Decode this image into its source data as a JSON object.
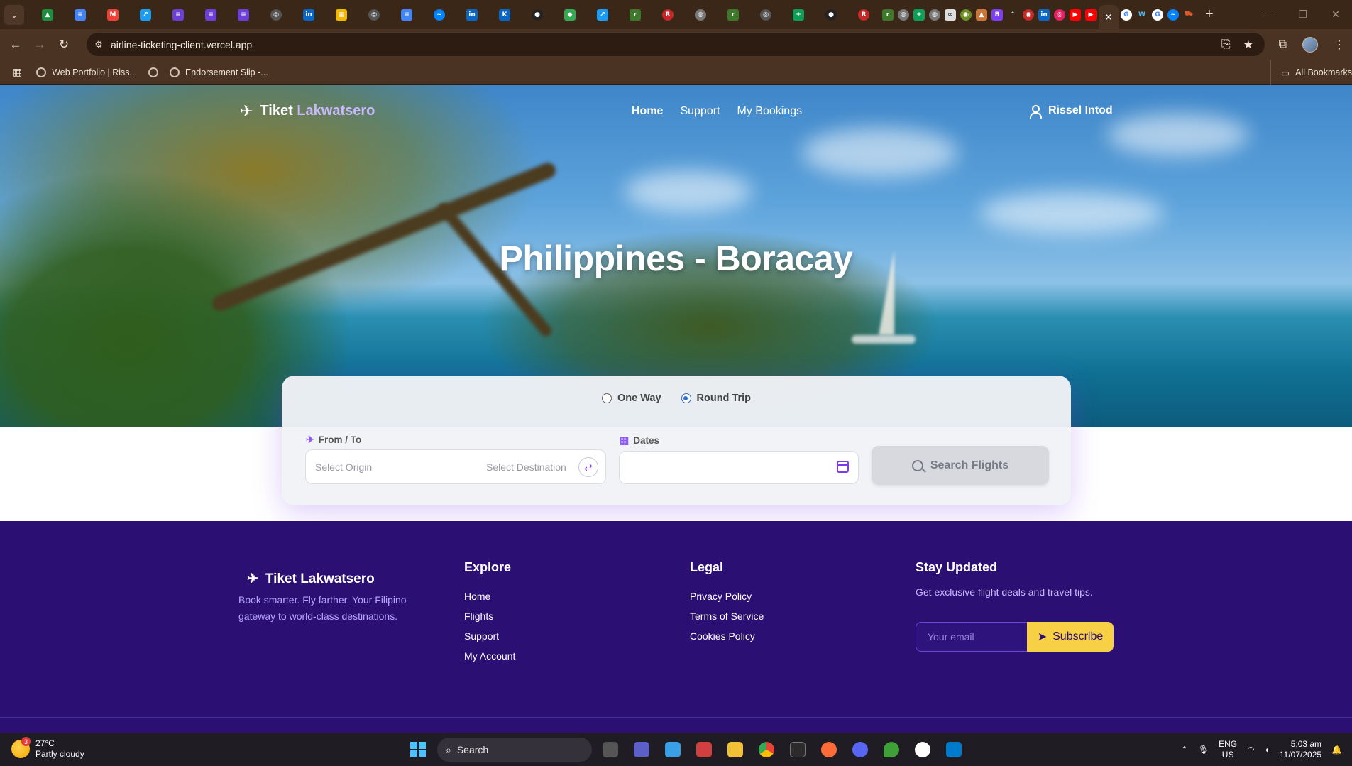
{
  "browser": {
    "url": "airline-ticketing-client.vercel.app",
    "bookmarks": [
      "Web Portfolio | Riss...",
      "Endorsement Slip -..."
    ],
    "all_bookmarks": "All Bookmarks"
  },
  "site": {
    "brand_first": "Tiket",
    "brand_second": "Lakwatsero",
    "nav": [
      "Home",
      "Support",
      "My Bookings"
    ],
    "user_name": "Rissel Intod",
    "hero_title": "Philippines - Boracay"
  },
  "search": {
    "one_way": "One Way",
    "round_trip": "Round Trip",
    "selected_trip": "Round Trip",
    "from_to_label": "From / To",
    "origin_placeholder": "Select Origin",
    "destination_placeholder": "Select Destination",
    "dates_label": "Dates",
    "search_button": "Search Flights"
  },
  "footer": {
    "brand": "Tiket Lakwatsero",
    "tagline": "Book smarter. Fly farther. Your Filipino gateway to world-class destinations.",
    "explore_title": "Explore",
    "explore_links": [
      "Home",
      "Flights",
      "Support",
      "My Account"
    ],
    "legal_title": "Legal",
    "legal_links": [
      "Privacy Policy",
      "Terms of Service",
      "Cookies Policy"
    ],
    "news_title": "Stay Updated",
    "news_text": "Get exclusive flight deals and travel tips.",
    "email_placeholder": "Your email",
    "subscribe": "Subscribe"
  },
  "taskbar": {
    "temperature": "27°C",
    "weather": "Partly cloudy",
    "weather_badge": "3",
    "search": "Search",
    "lang_top": "ENG",
    "lang_bottom": "US",
    "time": "5:03 am",
    "date": "11/07/2025"
  },
  "colors": {
    "brand_accent": "#c9b8ff",
    "footer_bg": "#2b0f72",
    "subscribe_bg": "#f7d046",
    "radio_selected": "#2f6fd6"
  }
}
